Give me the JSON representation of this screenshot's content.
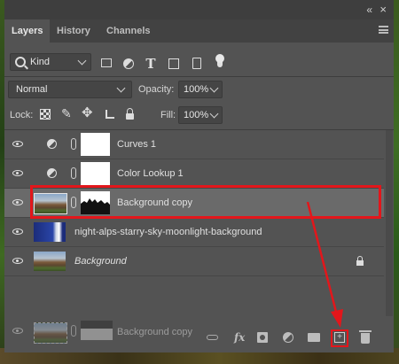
{
  "tabs": [
    "Layers",
    "History",
    "Channels"
  ],
  "filter": {
    "kind_label": "Kind"
  },
  "blend_mode": "Normal",
  "opacity": {
    "label": "Opacity:",
    "value": "100%"
  },
  "lock": {
    "label": "Lock:"
  },
  "fill": {
    "label": "Fill:",
    "value": "100%"
  },
  "layers": [
    {
      "name": "Curves 1",
      "type": "adjustment",
      "selected": false
    },
    {
      "name": "Color Lookup 1",
      "type": "adjustment",
      "selected": false
    },
    {
      "name": "Background copy",
      "type": "image-with-mask",
      "selected": true
    },
    {
      "name": "night-alps-starry-sky-moonlight-background",
      "type": "image",
      "selected": false
    },
    {
      "name": "Background",
      "type": "background",
      "locked": true,
      "selected": false
    }
  ],
  "drag_ghost": {
    "name": "Background copy"
  },
  "annotation_color": "#e3161b"
}
